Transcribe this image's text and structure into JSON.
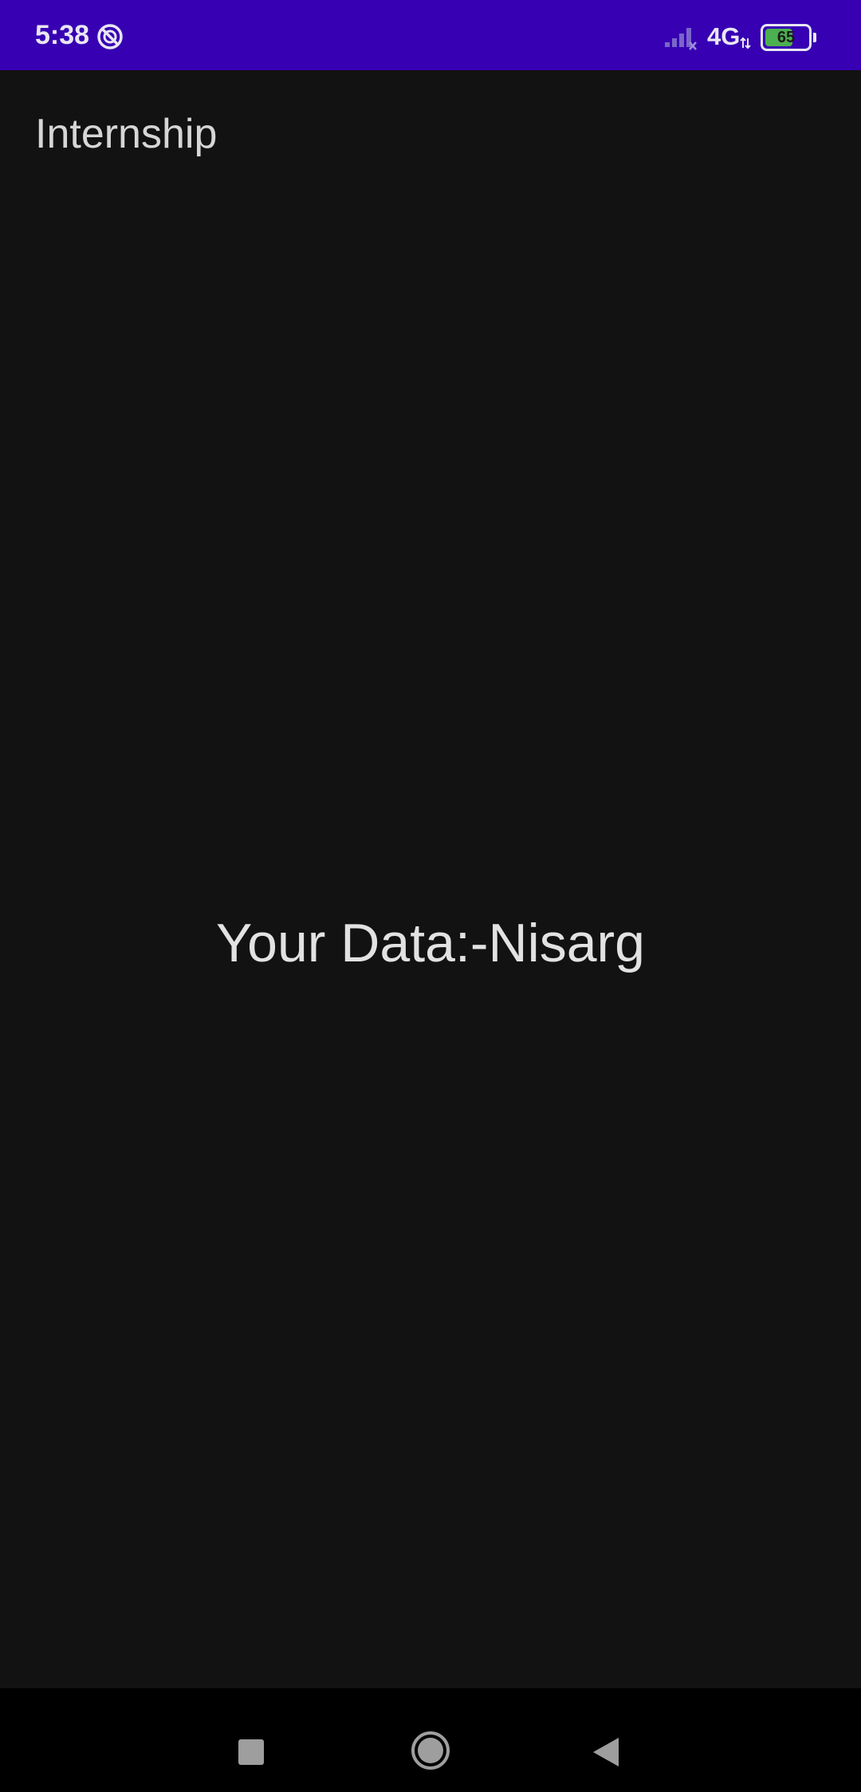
{
  "status_bar": {
    "time": "5:38",
    "network": "4G",
    "battery_level": "65",
    "battery_percent": 65,
    "background_color": "#3700B3",
    "icons": [
      "dnd-icon",
      "signal-icon",
      "data-arrows-icon",
      "battery-icon"
    ]
  },
  "app_bar": {
    "title": "Internship"
  },
  "main": {
    "data_text": "Your Data:-Nisarg"
  },
  "nav_bar": {
    "icons": [
      "recents-icon",
      "home-icon",
      "back-icon"
    ]
  },
  "colors": {
    "background": "#121212",
    "status_bar": "#3700B3",
    "battery_fill": "#4caf50"
  }
}
